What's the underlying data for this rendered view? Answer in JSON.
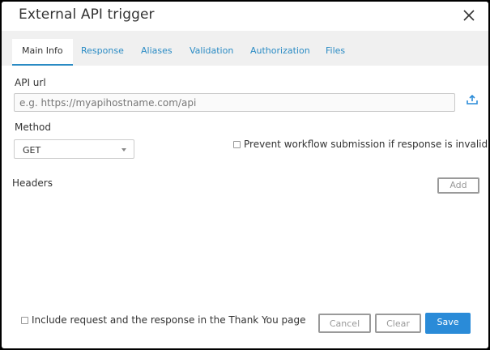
{
  "dialog": {
    "title": "External API trigger"
  },
  "tabs": [
    {
      "label": "Main Info",
      "active": true
    },
    {
      "label": "Response",
      "active": false
    },
    {
      "label": "Aliases",
      "active": false
    },
    {
      "label": "Validation",
      "active": false
    },
    {
      "label": "Authorization",
      "active": false
    },
    {
      "label": "Files",
      "active": false
    }
  ],
  "form": {
    "api_url_label": "API url",
    "api_url_value": "",
    "api_url_placeholder": "e.g. https://myapihostname.com/api",
    "method_label": "Method",
    "method_value": "GET",
    "prevent_label": "Prevent workflow submission if response is invalid",
    "headers_label": "Headers",
    "add_label": "Add",
    "include_label": "Include request and the response in the Thank You page"
  },
  "footer": {
    "cancel_label": "Cancel",
    "clear_label": "Clear",
    "save_label": "Save"
  },
  "colors": {
    "accent": "#2a8bd8",
    "tab_link": "#2a8bc4",
    "tab_bar_bg": "#f0f0f0"
  },
  "icons": {
    "close": "close-icon",
    "upload": "upload-icon",
    "dropdown": "chevron-down-icon"
  }
}
